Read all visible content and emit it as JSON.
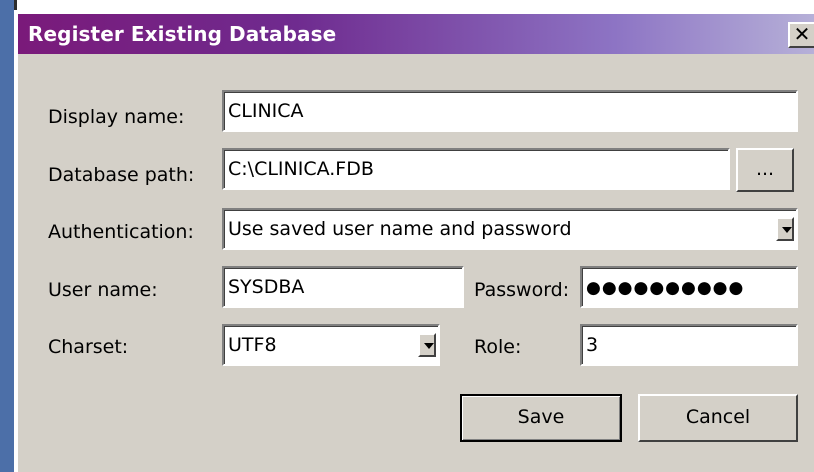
{
  "dialog": {
    "title": "Register Existing Database",
    "close_label": "✕"
  },
  "form": {
    "display_name_label": "Display name:",
    "display_name_value": "CLINICA",
    "database_path_label": "Database path:",
    "database_path_value": "C:\\CLINICA.FDB",
    "browse_label": "...",
    "authentication_label": "Authentication:",
    "authentication_value": "Use saved user name and password",
    "user_name_label": "User name:",
    "user_name_value": "SYSDBA",
    "password_label": "Password:",
    "password_mask": "●●●●●●●●●●",
    "charset_label": "Charset:",
    "charset_value": "UTF8",
    "role_label": "Role:",
    "role_value": "3"
  },
  "buttons": {
    "save_label": "Save",
    "cancel_label": "Cancel"
  },
  "colors": {
    "title_gradient_start": "#7a1a7a",
    "title_gradient_end": "#b6b0d8",
    "dialog_face": "#d4d0c8"
  }
}
